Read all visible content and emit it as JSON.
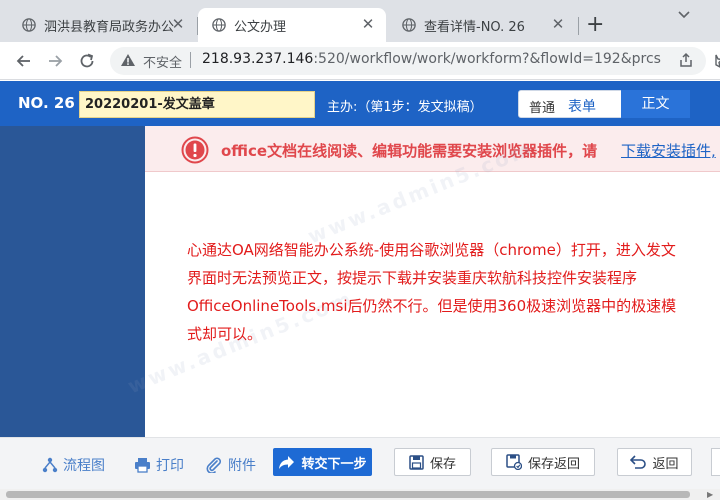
{
  "browser": {
    "tabs": [
      {
        "title": "泗洪县教育局政务办公",
        "active": false
      },
      {
        "title": "公文办理",
        "active": true
      },
      {
        "title": "查看详情-NO. 26",
        "active": false
      }
    ],
    "address": {
      "security_label": "不安全",
      "url_host": "218.93.237.146",
      "url_rest": ":520/workflow/work/workform?&flowId=192&prcsI..."
    }
  },
  "header": {
    "doc_number": "NO. 26",
    "doc_title": "20220201-发文盖章",
    "step": "主办:（第1步：发文拟稿）",
    "view_partial": "普通",
    "view_form": "表单",
    "view_body": "正文"
  },
  "alert": {
    "text": "office文档在线阅读、编辑功能需要安装浏览器插件，请",
    "link": "下载安装插件,"
  },
  "note": {
    "text": "心通达OA网络智能办公系统-使用谷歌浏览器（chrome）打开，进入发文界面时无法预览正文，按提示下载并安装重庆软航科技控件安装程序OfficeOnlineTools.msi后仍然不行。但是使用360极速浏览器中的极速模式却可以。"
  },
  "watermark": "www.admin5.com",
  "bottom_bar": {
    "flowchart": "流程图",
    "print": "打印",
    "attachment": "附件",
    "forward": "转交下一步",
    "save": "保存",
    "save_return": "保存返回",
    "back": "返回"
  },
  "colors": {
    "header_blue": "#1e63c5",
    "left_panel": "#2a5797",
    "alert_red": "#e0474c",
    "note_red": "#e21b1b"
  }
}
